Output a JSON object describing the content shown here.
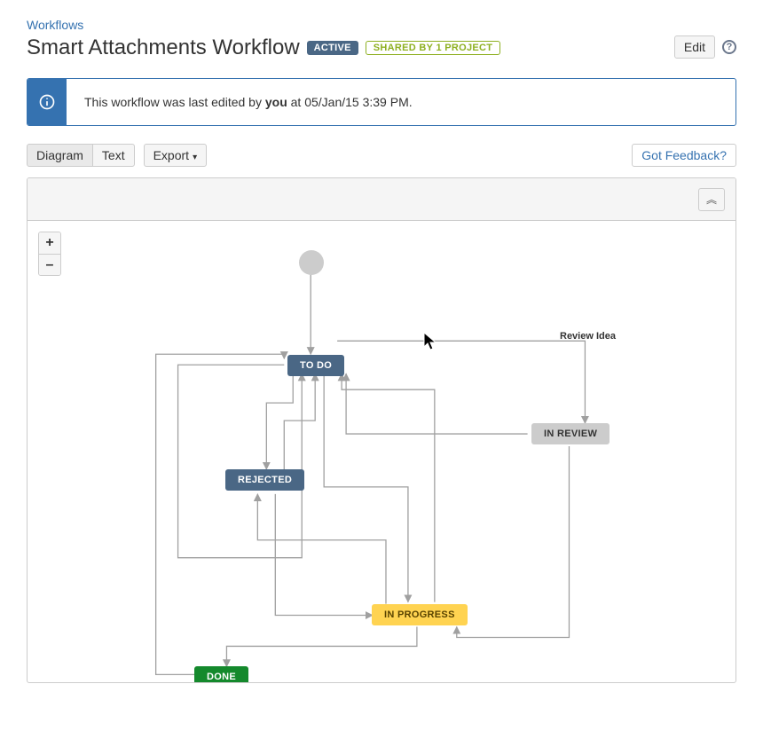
{
  "breadcrumb": {
    "link": "Workflows"
  },
  "title": "Smart Attachments Workflow",
  "badges": {
    "active": "ACTIVE",
    "shared": "SHARED BY 1 PROJECT"
  },
  "buttons": {
    "edit": "Edit",
    "feedback": "Got Feedback?"
  },
  "info": {
    "prefix": "This workflow was last edited by ",
    "user": "you",
    "suffix": " at 05/Jan/15 3:39 PM."
  },
  "tabs": {
    "diagram": "Diagram",
    "text": "Text"
  },
  "export": "Export",
  "zoom": {
    "in": "+",
    "out": "–"
  },
  "collapse": "︽",
  "nodes": {
    "todo": "TO DO",
    "inreview": "IN REVIEW",
    "rejected": "REJECTED",
    "inprogress": "IN PROGRESS",
    "done": "DONE"
  },
  "transitions": {
    "review_idea": "Review Idea"
  }
}
